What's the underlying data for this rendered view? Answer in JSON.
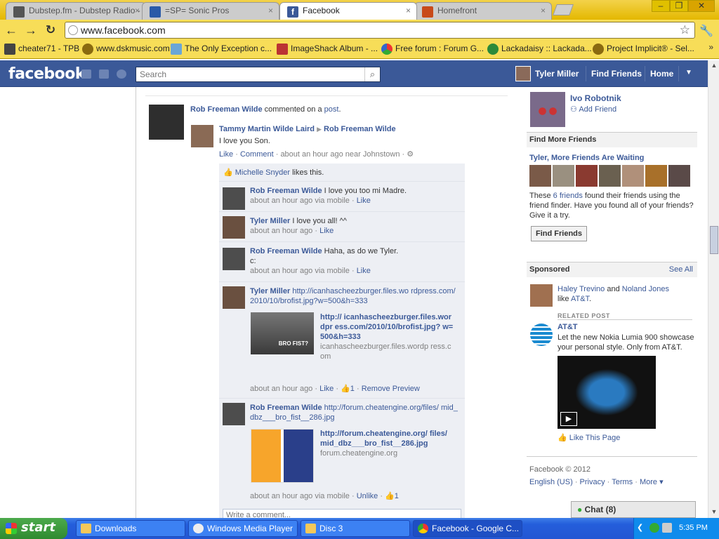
{
  "browser": {
    "tabs": [
      {
        "title": "Dubstep.fm - Dubstep Radio -",
        "color": "#555"
      },
      {
        "title": "=SP= Sonic Pros",
        "color": "#2a5aa8"
      },
      {
        "title": "Facebook",
        "color": "#3b5998"
      },
      {
        "title": "Homefront",
        "color": "#c84a1a"
      }
    ],
    "url": "www.facebook.com",
    "bookmarks": [
      "cheater71 - TPB",
      "www.dskmusic.com",
      "The Only Exception c...",
      "ImageShack Album - ...",
      "Free forum : Forum G...",
      "Lackadaisy :: Lackada...",
      "Project Implicit® - Sel..."
    ],
    "more_bookmarks": "»"
  },
  "fb": {
    "logo": "facebook",
    "search_placeholder": "Search",
    "user": "Tyler Miller",
    "find_friends": "Find Friends",
    "home": "Home"
  },
  "story": {
    "actor": "Rob Freeman Wilde",
    "action": "commented on a",
    "object": "post",
    "post_author": "Tammy Martin Wilde Laird",
    "post_target": "Rob Freeman Wilde",
    "post_text": "I love you Son.",
    "like": "Like",
    "comment": "Comment",
    "post_meta": "about an hour ago near Johnstown",
    "likers_name": "Michelle Snyder",
    "likers_suffix": "likes this.",
    "comments": [
      {
        "name": "Rob Freeman Wilde",
        "text": "I love you too mi Madre.",
        "meta": "about an hour ago via mobile",
        "like": "Like"
      },
      {
        "name": "Tyler Miller",
        "text": "I love you all! ^^",
        "meta": "about an hour ago",
        "like": "Like"
      },
      {
        "name": "Rob Freeman Wilde",
        "text": "Haha, as do we Tyler.",
        "text2": "c:",
        "meta": "about an hour ago via mobile",
        "like": "Like"
      },
      {
        "name": "Tyler Miller",
        "link": "http://icanhascheezburger.files.wo rdpress.com/2010/10/brofist.jpg?w=500&h=333",
        "preview_title": "http:// icanhascheezburger.files.wordpr ess.com/2010/10/brofist.jpg? w=500&h=333",
        "preview_domain": "icanhascheezburger.files.wordp ress.com",
        "thumb_caption": "BRO FIST?",
        "meta": "about an hour ago",
        "like": "Like",
        "likes": "1",
        "remove": "Remove Preview"
      },
      {
        "name": "Rob Freeman Wilde",
        "link": "http://forum.cheatengine.org/files/ mid_dbz___bro_fist__286.jpg",
        "preview_title": "http://forum.cheatengine.org/ files/ mid_dbz___bro_fist__286.jpg",
        "preview_domain": "forum.cheatengine.org",
        "meta": "about an hour ago via mobile",
        "like": "Unlike",
        "likes": "1"
      }
    ],
    "write_comment": "Write a comment..."
  },
  "right": {
    "suggested_name": "Ivo Robotnik",
    "add_friend": "Add Friend",
    "find_more_header": "Find More Friends",
    "waiting_title": "Tyler, More Friends Are Waiting",
    "waiting_text_a": "These",
    "waiting_link": "6 friends",
    "waiting_text_b": "found their friends using the friend finder. Have you found all of your friends? Give it a try.",
    "find_friends_btn": "Find Friends",
    "sponsored": "Sponsored",
    "see_all": "See All",
    "ad_name1": "Haley Trevino",
    "ad_and": "and",
    "ad_name2": "Noland Jones",
    "ad_like": "like",
    "ad_brand": "AT&T",
    "related_post": "RELATED POST",
    "ad_title": "AT&T",
    "ad_text": "Let the new Nokia Lumia 900 showcase your personal style. Only from AT&T.",
    "like_page": "Like This Page",
    "copyright": "Facebook © 2012",
    "footer_links": [
      "English (US)",
      "Privacy",
      "Terms",
      "More ▾"
    ],
    "chat": "Chat (8)"
  },
  "taskbar": {
    "start": "start",
    "tasks": [
      "Downloads",
      "Windows Media Player",
      "Disc 3",
      "Facebook - Google C..."
    ],
    "clock": "5:35 PM"
  }
}
